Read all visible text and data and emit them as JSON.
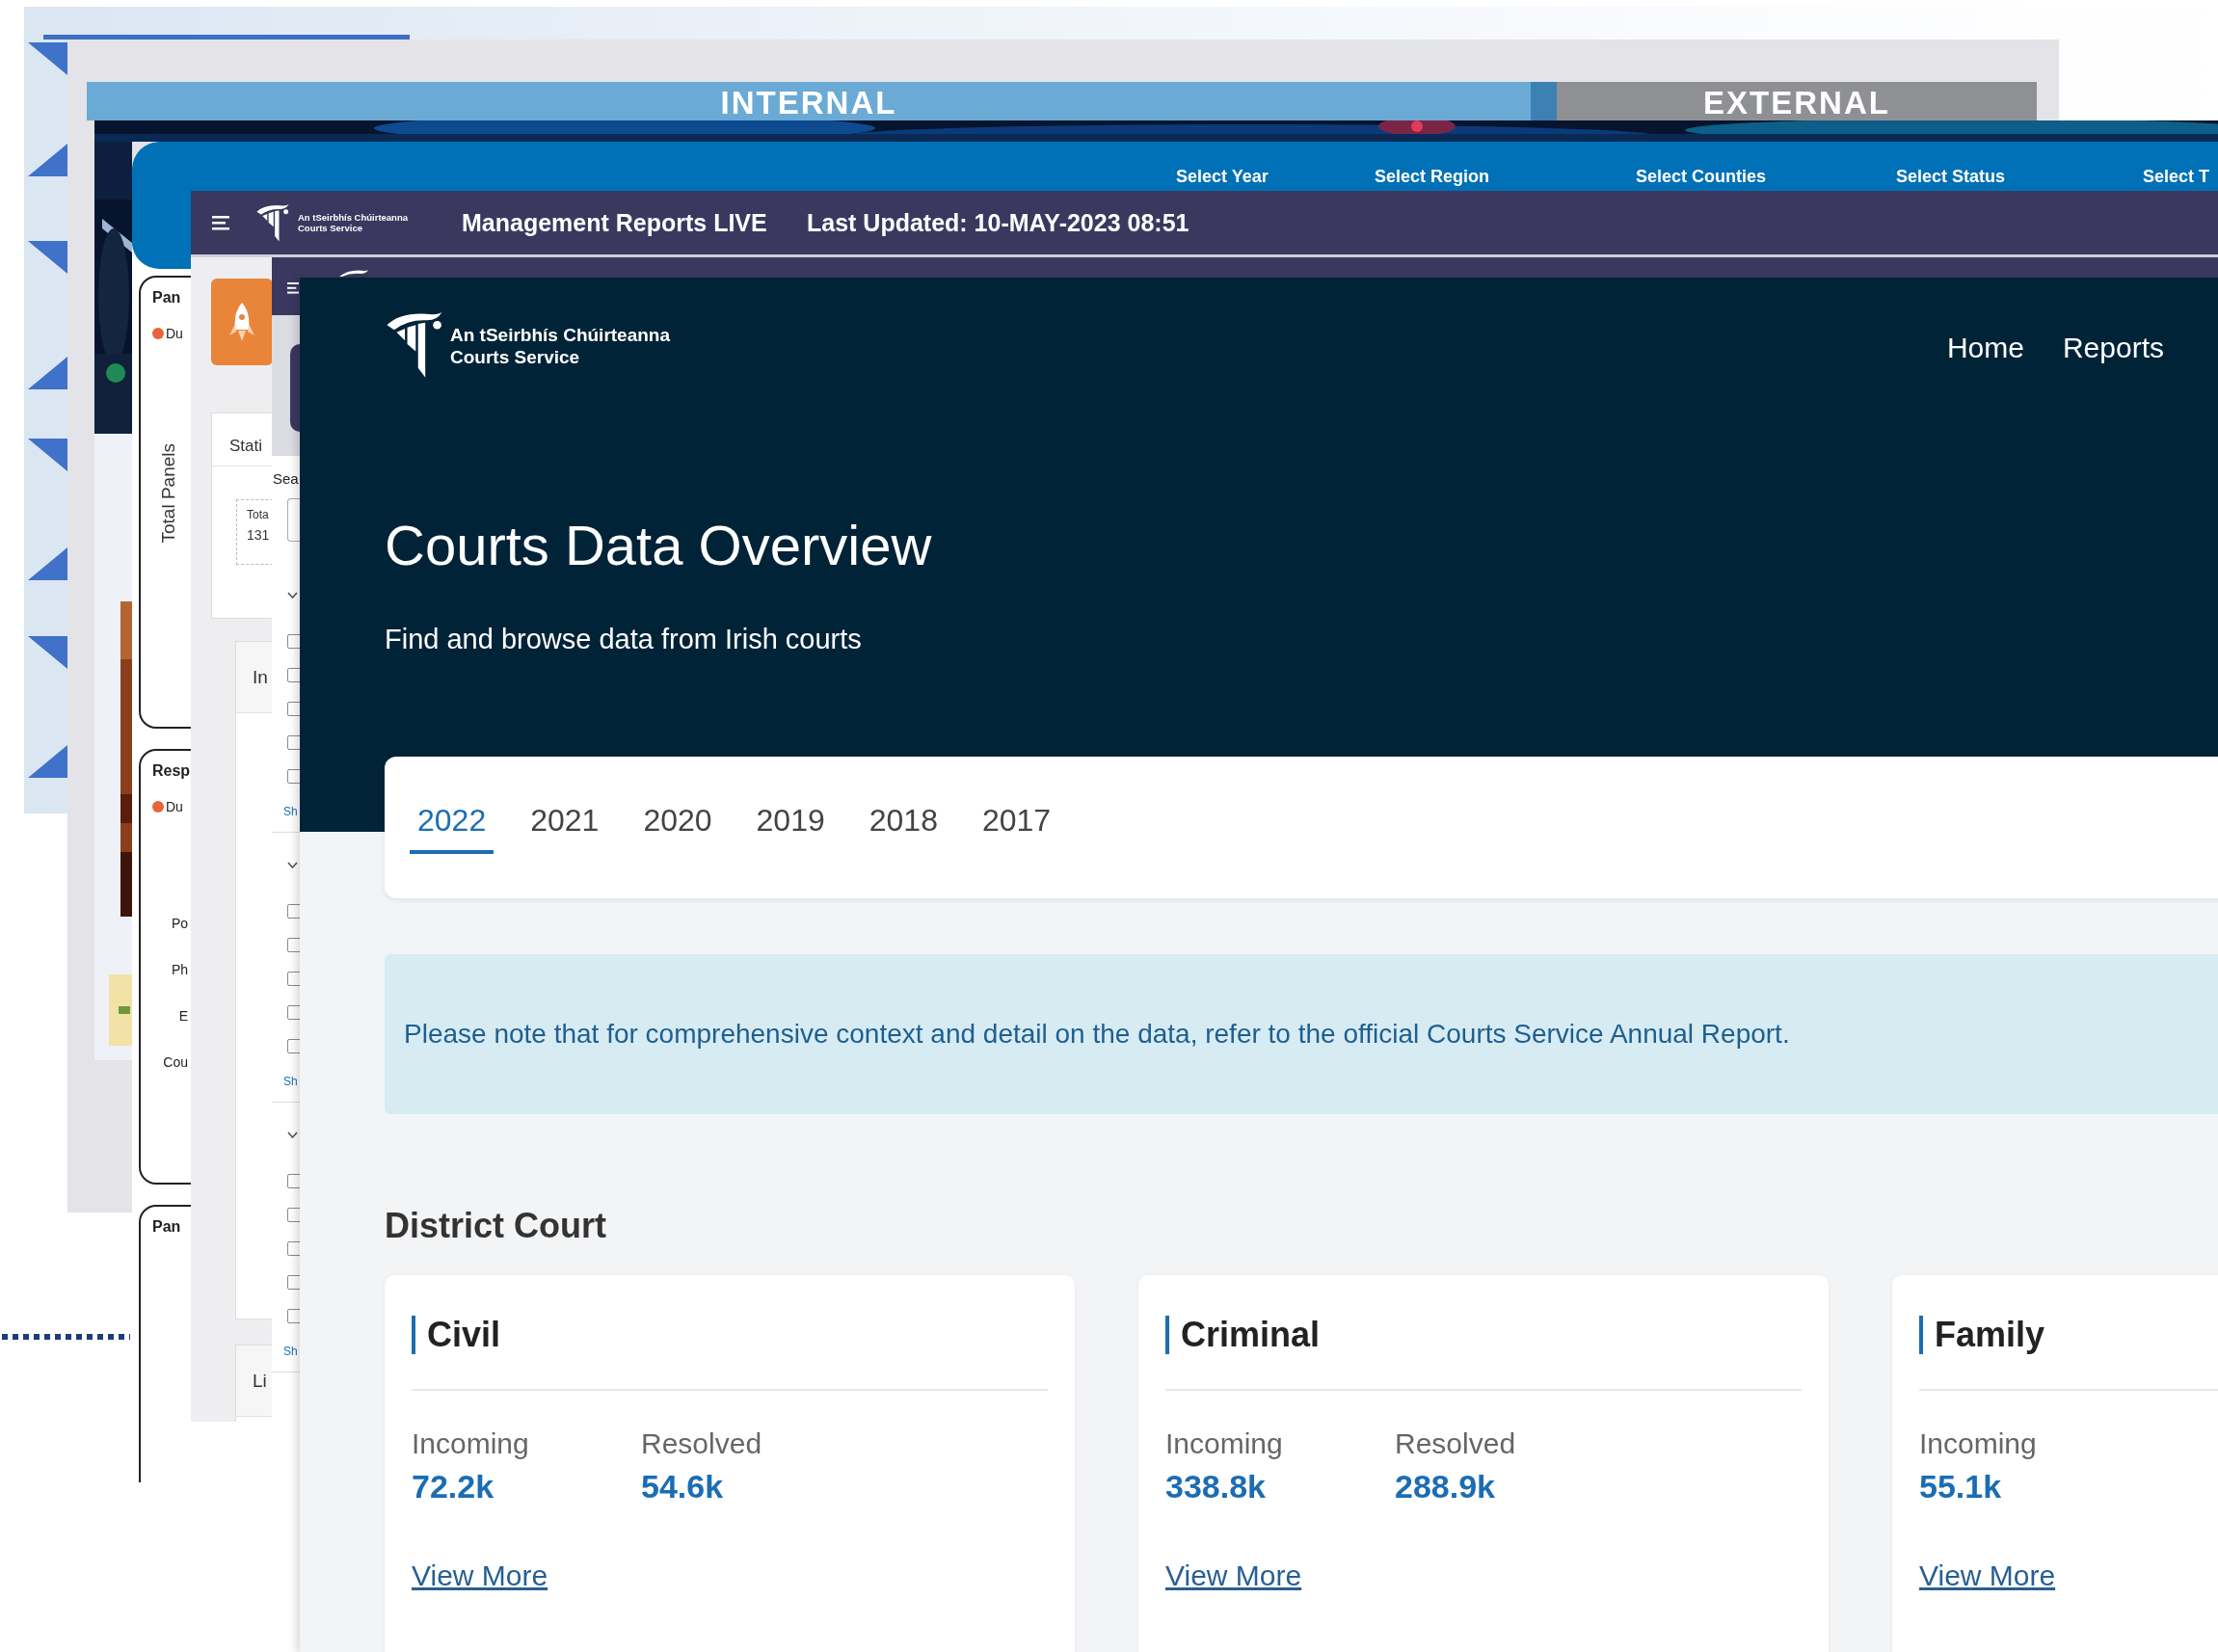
{
  "portal": {
    "tabs": [
      {
        "label": "INTERNAL",
        "selected": true
      },
      {
        "label": "EXTERNAL",
        "selected": false
      }
    ]
  },
  "panels": {
    "filters": [
      "Select Year",
      "Select Region",
      "Select Counties",
      "Select Status",
      "Select T"
    ],
    "cards": [
      {
        "title": "Pan",
        "legend": "Du",
        "axis_label": "Total Panels"
      },
      {
        "title": "Resp",
        "legend": "Du",
        "rows": [
          "Po",
          "Ph",
          "E",
          "Cou"
        ]
      },
      {
        "title": "Pan"
      }
    ]
  },
  "reports": {
    "logo": [
      "An tSeirbhís Chúirteanna",
      "Courts Service"
    ],
    "title": "Management Reports LIVE",
    "updated": "Last Updated: 10-MAY-2023 08:51",
    "stats": {
      "title": "Stati",
      "label": "Tota",
      "value": "131"
    },
    "sections": [
      "In",
      "Li"
    ]
  },
  "search": {
    "label": "Sea",
    "groups": [
      {
        "options": [
          {
            "checked": false
          },
          {
            "checked": false
          },
          {
            "checked": false
          },
          {
            "checked": false
          },
          {
            "checked": false
          }
        ],
        "link": "Sh"
      },
      {
        "options": [
          {
            "checked": false
          },
          {
            "checked": false
          },
          {
            "checked": false
          },
          {
            "checked": false
          },
          {
            "checked": false
          }
        ],
        "link": "Sh"
      },
      {
        "options": [
          {
            "checked": false
          },
          {
            "checked": false
          },
          {
            "checked": false
          },
          {
            "checked": false
          },
          {
            "checked": false
          }
        ],
        "link": "Sh"
      }
    ]
  },
  "courts": {
    "logo": [
      "An tSeirbhís Chúirteanna",
      "Courts Service"
    ],
    "nav": [
      "Home",
      "Reports"
    ],
    "title": "Courts Data Overview",
    "subtitle": "Find and browse data from Irish courts",
    "year_tabs": [
      {
        "label": "2022",
        "selected": true
      },
      {
        "label": "2021",
        "selected": false
      },
      {
        "label": "2020",
        "selected": false
      },
      {
        "label": "2019",
        "selected": false
      },
      {
        "label": "2018",
        "selected": false
      },
      {
        "label": "2017",
        "selected": false
      }
    ],
    "notice": "Please note that for comprehensive context and detail on the data, refer to the official Courts Service Annual Report.",
    "section_title": "District Court",
    "cards": [
      {
        "title": "Civil",
        "metrics": [
          {
            "label": "Incoming",
            "value": "72.2k"
          },
          {
            "label": "Resolved",
            "value": "54.6k"
          }
        ],
        "link": "View More"
      },
      {
        "title": "Criminal",
        "metrics": [
          {
            "label": "Incoming",
            "value": "338.8k"
          },
          {
            "label": "Resolved",
            "value": "288.9k"
          }
        ],
        "link": "View More"
      },
      {
        "title": "Family",
        "metrics": [
          {
            "label": "Incoming",
            "value": "55.1k"
          }
        ],
        "link": "View More"
      }
    ]
  }
}
